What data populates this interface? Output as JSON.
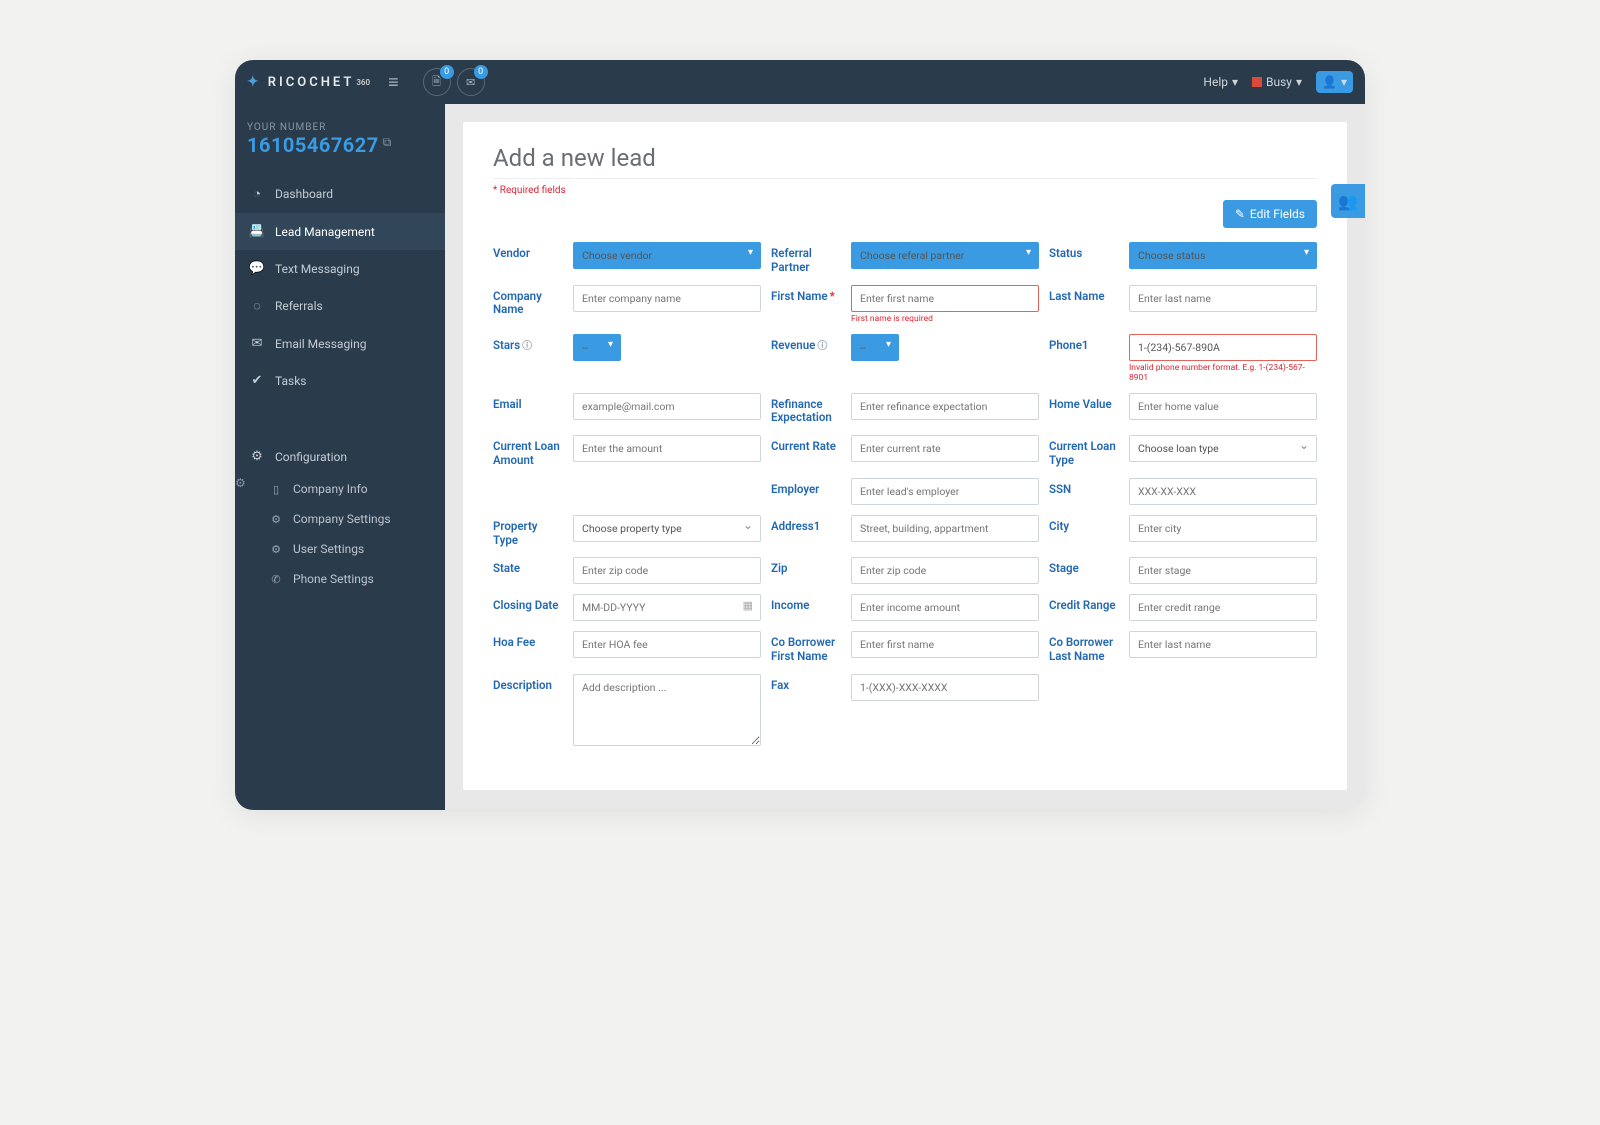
{
  "brand": "RICOCHET",
  "brand_sup": "360",
  "top_badges": {
    "doc": "0",
    "mail": "0"
  },
  "help": "Help",
  "status": "Busy",
  "your_number_label": "YOUR NUMBER",
  "your_number": "16105467627",
  "nav": [
    {
      "label": "Dashboard"
    },
    {
      "label": "Lead Management"
    },
    {
      "label": "Text Messaging"
    },
    {
      "label": "Referrals"
    },
    {
      "label": "Email Messaging"
    },
    {
      "label": "Tasks"
    }
  ],
  "config_head": "Configuration",
  "config": [
    {
      "label": "Company Info"
    },
    {
      "label": "Company Settings"
    },
    {
      "label": "User Settings"
    },
    {
      "label": "Phone Settings"
    }
  ],
  "page_title": "Add a new lead",
  "required_note": "* Required fields",
  "edit_fields": "Edit Fields",
  "fields": {
    "vendor": {
      "label": "Vendor",
      "placeholder": "Choose vendor"
    },
    "referral": {
      "label": "Referral Partner",
      "placeholder": "Choose referal partner"
    },
    "status": {
      "label": "Status",
      "placeholder": "Choose status"
    },
    "company": {
      "label": "Company Name",
      "placeholder": "Enter company name"
    },
    "first_name": {
      "label": "First Name",
      "placeholder": "Enter first name",
      "error": "First name is required"
    },
    "last_name": {
      "label": "Last Name",
      "placeholder": "Enter last name"
    },
    "stars": {
      "label": "Stars",
      "placeholder": "--"
    },
    "revenue": {
      "label": "Revenue",
      "placeholder": "--"
    },
    "phone1": {
      "label": "Phone1",
      "value": "1-(234)-567-890A",
      "error": "Invalid phone number format. E.g. 1-(234)-567-8901"
    },
    "email": {
      "label": "Email",
      "placeholder": "example@mail.com"
    },
    "refi": {
      "label": "Refinance Expectation",
      "placeholder": "Enter refinance expectation"
    },
    "home_value": {
      "label": "Home Value",
      "placeholder": "Enter home value"
    },
    "loan_amount": {
      "label": "Current Loan Amount",
      "placeholder": "Enter the amount"
    },
    "rate": {
      "label": "Current Rate",
      "placeholder": "Enter current rate"
    },
    "loan_type": {
      "label": "Current Loan Type",
      "placeholder": "Choose loan type"
    },
    "employer": {
      "label": "Employer",
      "placeholder": "Enter lead's employer"
    },
    "ssn": {
      "label": "SSN",
      "placeholder": "XXX-XX-XXX"
    },
    "property_type": {
      "label": "Property Type",
      "placeholder": "Choose property type"
    },
    "address1": {
      "label": "Address1",
      "placeholder": "Street, building, appartment"
    },
    "city": {
      "label": "City",
      "placeholder": "Enter city"
    },
    "state": {
      "label": "State",
      "placeholder": "Enter zip code"
    },
    "zip": {
      "label": "Zip",
      "placeholder": "Enter zip code"
    },
    "stage": {
      "label": "Stage",
      "placeholder": "Enter stage"
    },
    "closing_date": {
      "label": "Closing Date",
      "placeholder": "MM-DD-YYYY"
    },
    "income": {
      "label": "Income",
      "placeholder": "Enter income amount"
    },
    "credit": {
      "label": "Credit Range",
      "placeholder": "Enter credit range"
    },
    "hoa": {
      "label": "Hoa Fee",
      "placeholder": "Enter HOA fee"
    },
    "co_fn": {
      "label": "Co Borrower First Name",
      "placeholder": "Enter first name"
    },
    "co_ln": {
      "label": "Co Borrower Last Name",
      "placeholder": "Enter last name"
    },
    "desc": {
      "label": "Description",
      "placeholder": "Add description ..."
    },
    "fax": {
      "label": "Fax",
      "placeholder": "1-(XXX)-XXX-XXXX"
    }
  }
}
